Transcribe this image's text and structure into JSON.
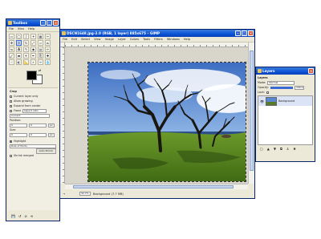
{
  "toolbox": {
    "title": "Toolbox",
    "menu": [
      "File",
      "Xtns",
      "Help"
    ],
    "tools": [
      "rect-select",
      "ellipse-select",
      "free-select",
      "fuzzy-select",
      "color-select",
      "scissors",
      "move",
      "crop",
      "rotate",
      "scale",
      "shear",
      "perspective",
      "flip",
      "text",
      "color-picker",
      "bucket-fill",
      "blend",
      "pencil",
      "paintbrush",
      "eraser",
      "airbrush",
      "ink",
      "clone",
      "heal",
      "smudge",
      "dodge",
      "measure",
      "zoom",
      "paths",
      "convolve"
    ],
    "options_title": "Crop",
    "options": {
      "current_layer_only": "Current layer only",
      "allow_growing": "Allow growing",
      "expand_from_center": "Expand from center",
      "fixed_label": "Fixed",
      "fixed_value": "Aspect ratio",
      "ratio_value": "Current",
      "position_label": "Position:",
      "position_x": "0",
      "position_y": "0",
      "size_label": "Size:",
      "size_x": "0",
      "size_y": "0",
      "highlight_label": "Highlight",
      "guides_label": "Rule of thirds",
      "auto_shrink": "Auto Shrink",
      "shrink_merged": "Shrink merged"
    }
  },
  "image_window": {
    "title": "DSCN1648.jpg-2.0 (RGB, 1 layer) 885x675 – GIMP",
    "menu": [
      "File",
      "Edit",
      "Select",
      "View",
      "Image",
      "Layer",
      "Colors",
      "Tools",
      "Filters",
      "Windows",
      "Help"
    ],
    "zoom": "32.7%",
    "status": "Background (7.7 MB)"
  },
  "layers": {
    "title": "Layers",
    "panel_label": "Layers",
    "mode_label": "Mode:",
    "mode_value": "Normal",
    "opacity_label": "Opacity:",
    "opacity_value": "100.0",
    "lock_label": "Lock:",
    "layer_name": "Background"
  }
}
